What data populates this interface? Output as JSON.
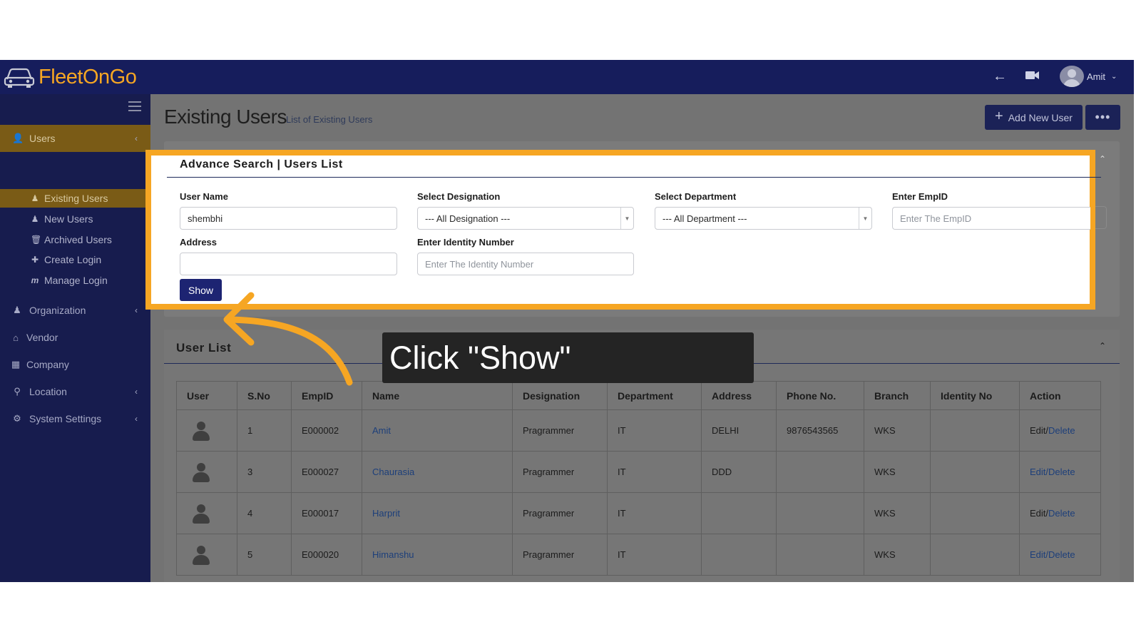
{
  "brand": {
    "name_part1": "Fleet",
    "name_part2": "On",
    "name_part3": "Go"
  },
  "topbar": {
    "user_name": "Amit"
  },
  "sidebar": {
    "items": [
      {
        "label": "Users",
        "icon": "user-icon",
        "active": true
      },
      {
        "label": "Organization",
        "icon": "user-icon"
      },
      {
        "label": "Vendor",
        "icon": "home-icon"
      },
      {
        "label": "Company",
        "icon": "building-icon"
      },
      {
        "label": "Location",
        "icon": "map-pin-icon"
      },
      {
        "label": "System Settings",
        "icon": "gear-icon"
      }
    ],
    "sub_items": [
      {
        "label": "Existing Users",
        "icon": "user-icon",
        "active": true
      },
      {
        "label": "New Users",
        "icon": "user-icon"
      },
      {
        "label": "Archived Users",
        "icon": "trash-icon"
      },
      {
        "label": "Create Login",
        "icon": "plus-icon"
      },
      {
        "label": "Manage Login",
        "icon": "manage-icon"
      }
    ]
  },
  "page": {
    "title": "Existing Users",
    "subtitle": "List of Existing Users",
    "add_button": "Add New User",
    "more_button": "•••"
  },
  "search": {
    "title": "Advance Search | Users List",
    "user_name_label": "User Name",
    "user_name_value": "shembhi",
    "designation_label": "Select Designation",
    "designation_value": "--- All Designation ---",
    "department_label": "Select Department",
    "department_value": "--- All Department ---",
    "empid_label": "Enter EmpID",
    "empid_placeholder": "Enter The EmpID",
    "address_label": "Address",
    "address_value": "",
    "identity_label": "Enter Identity Number",
    "identity_placeholder": "Enter The Identity Number",
    "show_button": "Show"
  },
  "user_list": {
    "title": "User List",
    "columns": [
      "User",
      "S.No",
      "EmpID",
      "Name",
      "Designation",
      "Department",
      "Address",
      "Phone No.",
      "Branch",
      "Identity No",
      "Action"
    ],
    "rows": [
      {
        "sno": "1",
        "empid": "E000002",
        "name": "Amit",
        "designation": "Pragrammer",
        "department": "IT",
        "address": "DELHI",
        "phone": "9876543565",
        "branch": "WKS",
        "identity": "",
        "edit": "Edit",
        "sep": "/",
        "delete": "Delete"
      },
      {
        "sno": "3",
        "empid": "E000027",
        "name": "Chaurasia",
        "designation": "Pragrammer",
        "department": "IT",
        "address": "DDD",
        "phone": "",
        "branch": "WKS",
        "identity": "",
        "edit": "Edit",
        "sep": "/",
        "delete": "Delete"
      },
      {
        "sno": "4",
        "empid": "E000017",
        "name": "Harprit",
        "designation": "Pragrammer",
        "department": "IT",
        "address": "",
        "phone": "",
        "branch": "WKS",
        "identity": "",
        "edit": "Edit",
        "sep": "/",
        "delete": "Delete"
      },
      {
        "sno": "5",
        "empid": "E000020",
        "name": "Himanshu",
        "designation": "Pragrammer",
        "department": "IT",
        "address": "",
        "phone": "",
        "branch": "WKS",
        "identity": "",
        "edit": "Edit",
        "sep": "/",
        "delete": "Delete"
      }
    ]
  },
  "callout": {
    "text": "Click \"Show\""
  },
  "colors": {
    "highlight": "#f6a623",
    "topbar": "#161d5c",
    "sidebar": "#171c4e",
    "active": "#7a5b16",
    "button": "#1d2472"
  }
}
